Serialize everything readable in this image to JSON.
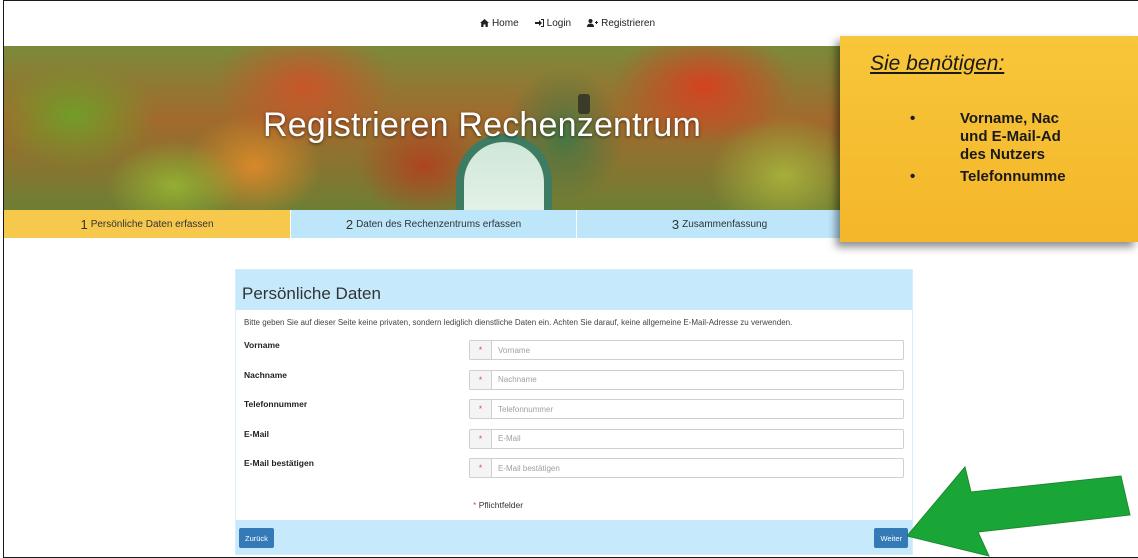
{
  "nav": {
    "home": "Home",
    "login": "Login",
    "register": "Registrieren"
  },
  "hero": {
    "title": "Registrieren Rechenzentrum"
  },
  "steps": [
    {
      "num": "1",
      "label": "Persönliche Daten erfassen",
      "active": true
    },
    {
      "num": "2",
      "label": "Daten des Rechenzentrums erfassen",
      "active": false
    },
    {
      "num": "3",
      "label": "Zusammenfassung",
      "active": false
    }
  ],
  "note": {
    "title": "Sie benötigen:",
    "items": [
      {
        "line1": "Vorname, Nac",
        "line2": "und E-Mail-Ad",
        "line3": "des Nutzers"
      },
      {
        "line1": "Telefonnumme"
      }
    ]
  },
  "form": {
    "heading": "Persönliche Daten",
    "description": "Bitte geben Sie auf dieser Seite keine privaten, sondern lediglich dienstliche Daten ein. Achten Sie darauf, keine allgemeine E-Mail-Adresse zu verwenden.",
    "fields": [
      {
        "label": "Vorname",
        "placeholder": "Vorname",
        "required_mark": "*"
      },
      {
        "label": "Nachname",
        "placeholder": "Nachname",
        "required_mark": "*"
      },
      {
        "label": "Telefonnummer",
        "placeholder": "Telefonnummer",
        "required_mark": "*"
      },
      {
        "label": "E-Mail",
        "placeholder": "E-Mail",
        "required_mark": "*"
      },
      {
        "label": "E-Mail bestätigen",
        "placeholder": "E-Mail bestätigen",
        "required_mark": "*"
      }
    ],
    "required_note_star": "*",
    "required_note": "Pflichtfelder",
    "back_label": "Zurück",
    "next_label": "Weiter"
  },
  "colors": {
    "step_active": "#f6c84c",
    "step_inactive": "#bde6fb",
    "panel_header": "#c6eafb",
    "note_bg": "#f6bf33",
    "button": "#337ab7",
    "arrow": "#1aa637"
  },
  "icons": {
    "home": "home-icon",
    "login": "sign-in-icon",
    "register": "user-plus-icon"
  }
}
